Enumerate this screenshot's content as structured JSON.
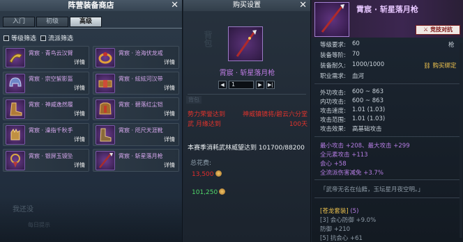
{
  "shop": {
    "title": "阵营装备商店",
    "tabs": [
      {
        "label": "入门"
      },
      {
        "label": "初级"
      },
      {
        "label": "高级"
      }
    ],
    "filters": [
      {
        "label": "等级筛选"
      },
      {
        "label": "流派筛选"
      }
    ],
    "items": [
      {
        "name": "霄宸 · 青鸟云汉臂",
        "detail": "详情",
        "icon": "armlet-icon"
      },
      {
        "name": "霄宸 · 沧海伏龙戒",
        "detail": "详情",
        "icon": "ring-icon"
      },
      {
        "name": "霄宸 · 宗空絮影盔",
        "detail": "详情",
        "icon": "helmet-icon"
      },
      {
        "name": "霄宸 · 絃絃河汉带",
        "detail": "详情",
        "icon": "belt-icon"
      },
      {
        "name": "霄宸 · 神威逸然履",
        "detail": "详情",
        "icon": "boots-icon"
      },
      {
        "name": "霄宸 · 碧落红尘铠",
        "detail": "详情",
        "icon": "armor-icon"
      },
      {
        "name": "霄宸 · 澡指千秋手",
        "detail": "详情",
        "icon": "gloves-icon"
      },
      {
        "name": "霄宸 · 咫尺天涯靴",
        "detail": "详情",
        "icon": "boots-icon"
      },
      {
        "name": "霄宸 · 银屏玉镜坠",
        "detail": "详情",
        "icon": "pendant-icon"
      },
      {
        "name": "霄宸 · 斩星落月枪",
        "detail": "详情",
        "icon": "spear-icon"
      }
    ],
    "faded_title": "我还没",
    "faded_note": "每日提示"
  },
  "buy": {
    "title": "购买设置",
    "bg_text": "背包",
    "item_name": "霄宸 · 斩星落月枪",
    "quantity": "1",
    "faded_tag": "背包",
    "requirement_line1_left": "势力荣誉达到",
    "requirement_line1_right": "神威镇镜将/碧云六分堂",
    "requirement_line2_left": "武 月缘达到",
    "requirement_line2_right": "100天",
    "progress": "本赛季消耗武林威望达到 101700/88200",
    "total_label": "总花费:",
    "cost1": "13,500",
    "cost2": "101,250"
  },
  "tooltip": {
    "name": "霄宸 · 斩星落月枪",
    "badge": "竞技对抗",
    "weapon_type": "枪",
    "level_req_label": "等级要求:",
    "level_req": "60",
    "equip_level_label": "装备等阶:",
    "equip_level": "70",
    "durability_label": "装备耐久:",
    "durability": "1000/1000",
    "bind_text": "购买绑定",
    "school_label": "职业需求:",
    "school": "血河",
    "ext_atk_label": "外功攻击:",
    "ext_atk": "600 ~ 863",
    "int_atk_label": "内功攻击:",
    "int_atk": "600 ~ 863",
    "atk_speed_label": "攻击速度:",
    "atk_speed": "1.01 (1.03)",
    "atk_range_label": "攻击范围:",
    "atk_range": "1.01 (1.03)",
    "atk_effect_label": "攻击效果:",
    "atk_effect": "高基础攻击",
    "bonus": [
      "最小攻击 +208、最大攻击 +299",
      "全元素攻击 +113",
      "会心 +58",
      "全流派伤害减免 +3.7%"
    ],
    "flavor": "「武帝无名在仙籍，玉坛星月夜空明。」",
    "set_title": "[苍龙套装]",
    "set_count": "(5)",
    "set_lines": [
      "[3] 会心防御 +9.0%",
      "防御 +210",
      "[5] 抗会心 +61"
    ]
  }
}
